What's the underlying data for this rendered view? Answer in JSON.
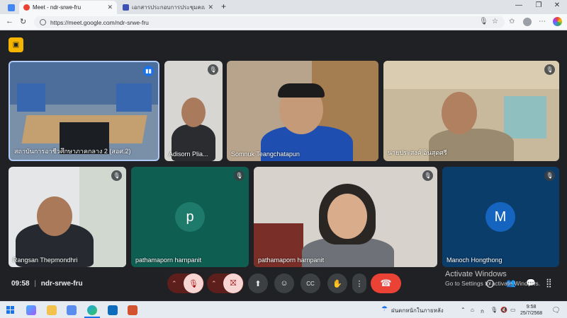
{
  "browser": {
    "tabs": [
      {
        "title": "Meet - ndr-srwe-fru",
        "active": true
      },
      {
        "title": "เอกสารประกอบการประชุมคณะกรรมก",
        "active": false
      }
    ],
    "url": "https://meet.google.com/ndr-srwe-fru"
  },
  "meet": {
    "time": "09:58",
    "separator": "|",
    "meeting_code": "ndr-srwe-fru",
    "participants": [
      {
        "name": "สถาบันการอาชีวศึกษาภาคกลาง 2 (สอศ.2)",
        "muted": false
      },
      {
        "name": "Adisorn Plia...",
        "muted": true
      },
      {
        "name": "Somnuk Teangchatapun",
        "muted": false
      },
      {
        "name": "นายประสงค์ อินสุดศรี",
        "muted": true
      },
      {
        "name": "Rangsan Thepmondhri",
        "muted": true
      },
      {
        "name": "pathamaporn harnpanit",
        "muted": true,
        "avatar_letter": "p",
        "avatar_color": "#1e7a6a"
      },
      {
        "name": "pathamaporn harnpanit",
        "muted": true
      },
      {
        "name": "Manoch Hongthong",
        "muted": true,
        "avatar_letter": "M",
        "avatar_color": "#1565c0"
      }
    ]
  },
  "activation": {
    "title": "Activate Windows",
    "subtitle": "Go to Settings to activate Windows."
  },
  "taskbar": {
    "weather": "ฝนตกหนักในภายหลัง",
    "time": "9:58",
    "date": "25/7/2568"
  },
  "colors": {
    "meet_bg": "#202124",
    "end_call": "#ea4335",
    "accent_yellow": "#f4b400"
  }
}
